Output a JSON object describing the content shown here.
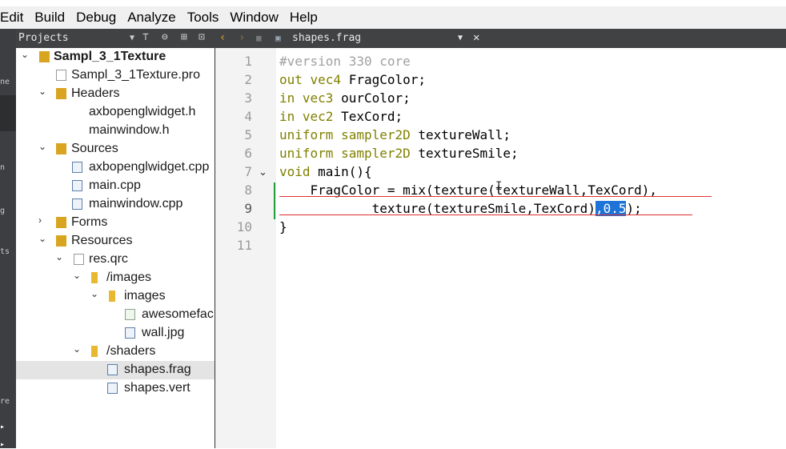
{
  "menu": [
    "Edit",
    "Build",
    "Debug",
    "Analyze",
    "Tools",
    "Window",
    "Help"
  ],
  "modebar": {
    "labels": [
      "ne",
      "n",
      "g",
      "ts",
      "re"
    ]
  },
  "projects": {
    "title": "Projects",
    "tree": [
      {
        "label": "Sampl_3_1Texture",
        "expanded": true
      },
      {
        "label": "Sampl_3_1Texture.pro"
      },
      {
        "label": "Headers",
        "expanded": true
      },
      {
        "label": "axbopenglwidget.h"
      },
      {
        "label": "mainwindow.h"
      },
      {
        "label": "Sources",
        "expanded": true
      },
      {
        "label": "axbopenglwidget.cpp"
      },
      {
        "label": "main.cpp"
      },
      {
        "label": "mainwindow.cpp"
      },
      {
        "label": "Forms",
        "expanded": false
      },
      {
        "label": "Resources",
        "expanded": true
      },
      {
        "label": "res.qrc",
        "expanded": true
      },
      {
        "label": "/images",
        "expanded": true
      },
      {
        "label": "images",
        "expanded": true
      },
      {
        "label": "awesomefac"
      },
      {
        "label": "wall.jpg"
      },
      {
        "label": "/shaders",
        "expanded": true
      },
      {
        "label": "shapes.frag",
        "selected": true
      },
      {
        "label": "shapes.vert"
      }
    ]
  },
  "editor": {
    "filename": "shapes.frag",
    "line_numbers": [
      "1",
      "2",
      "3",
      "4",
      "5",
      "6",
      "7",
      "8",
      "9",
      "10",
      "11"
    ],
    "lines": {
      "l1": "#version 330 core",
      "l2a": "out vec4",
      "l2b": " FragColor;",
      "l3a": "in vec3",
      "l3b": " ourColor;",
      "l4a": "in vec2",
      "l4b": " TexCord;",
      "l5a": "uniform sampler2D",
      "l5b": " textureWall;",
      "l6a": "uniform sampler2D",
      "l6b": " textureSmile;",
      "l7a": "void",
      "l7b": " main(){",
      "l8": "    FragColor = mix(texture(textureWall,TexCord),",
      "l9a": "            texture(textureSmile,TexCord)",
      "l9b": ",0.5",
      "l9c": ");",
      "l10": "}"
    },
    "colors": {
      "keyword": "#808000",
      "comment": "#a0a0a0",
      "selection": "#1e73d6",
      "error": "#e03030",
      "changed": "#1f9e3a"
    }
  }
}
